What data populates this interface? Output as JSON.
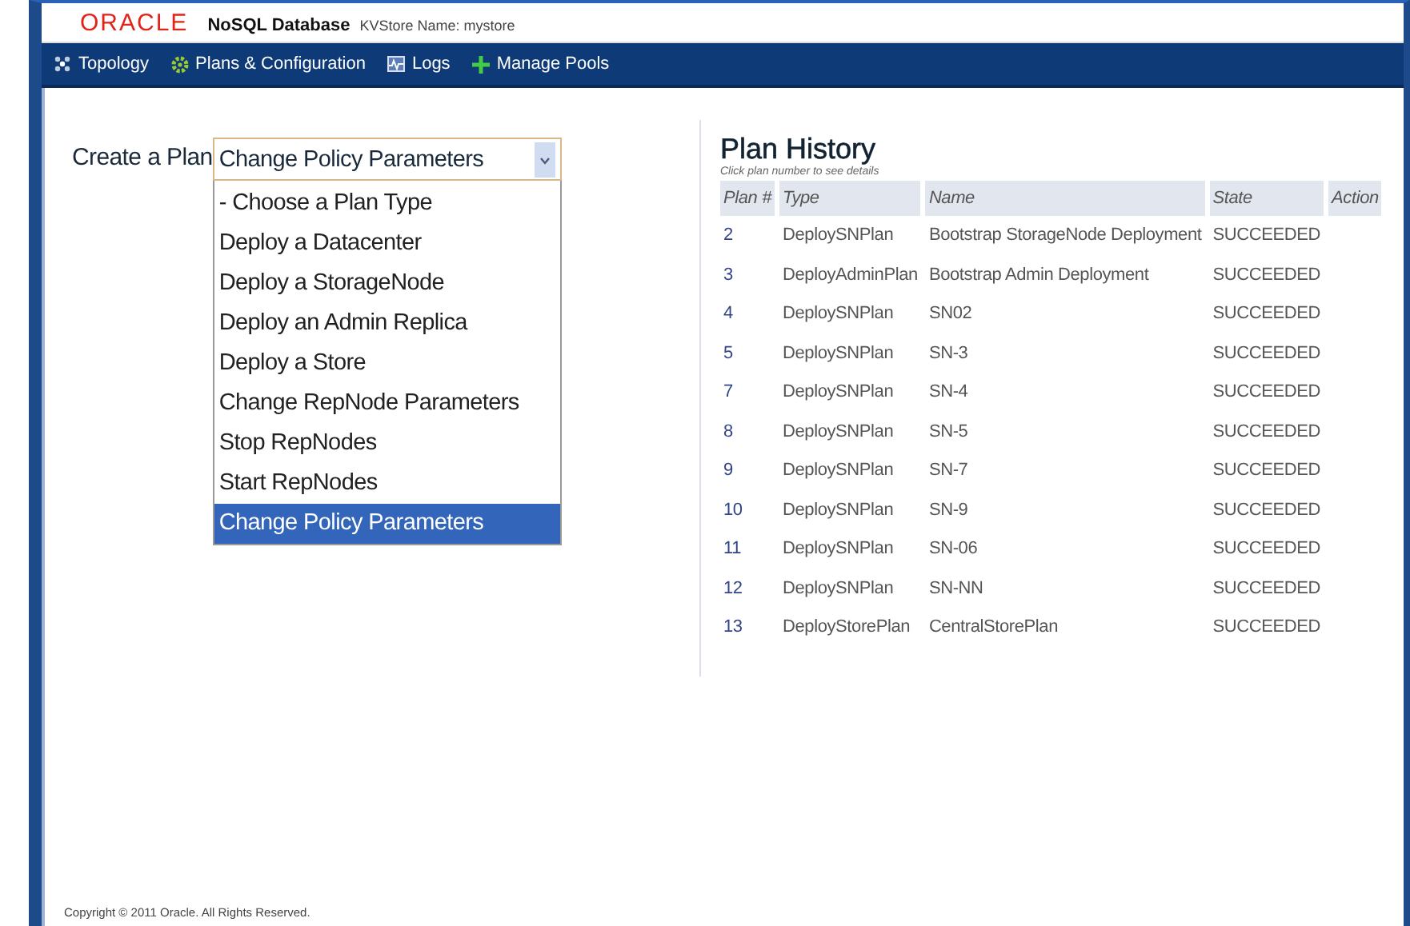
{
  "header": {
    "logo": "ORACLE",
    "product": "NoSQL Database",
    "store_label": "KVStore Name: mystore"
  },
  "nav": [
    {
      "label": "Topology"
    },
    {
      "label": "Plans & Configuration"
    },
    {
      "label": "Logs"
    },
    {
      "label": "Manage Pools"
    }
  ],
  "create_plan": {
    "label": "Create a Plan",
    "value": "Change Policy Parameters",
    "options": [
      {
        "label": "- Choose a Plan Type",
        "selected": false
      },
      {
        "label": "Deploy a Datacenter",
        "selected": false
      },
      {
        "label": "Deploy a StorageNode",
        "selected": false
      },
      {
        "label": "Deploy an Admin Replica",
        "selected": false
      },
      {
        "label": "Deploy a Store",
        "selected": false
      },
      {
        "label": "Change RepNode Parameters",
        "selected": false
      },
      {
        "label": "Stop RepNodes",
        "selected": false
      },
      {
        "label": "Start RepNodes",
        "selected": false
      },
      {
        "label": "Change Policy Parameters",
        "selected": true
      }
    ]
  },
  "plan_history": {
    "title": "Plan History",
    "hint": "Click plan number to see details",
    "columns": [
      "Plan #",
      "Type",
      "Name",
      "State",
      "Action"
    ],
    "rows": [
      [
        "2",
        "DeploySNPlan",
        "Bootstrap StorageNode Deployment",
        "SUCCEEDED"
      ],
      [
        "3",
        "DeployAdminPlan",
        "Bootstrap Admin Deployment",
        "SUCCEEDED"
      ],
      [
        "4",
        "DeploySNPlan",
        "SN02",
        "SUCCEEDED"
      ],
      [
        "5",
        "DeploySNPlan",
        "SN-3",
        "SUCCEEDED"
      ],
      [
        "7",
        "DeploySNPlan",
        "SN-4",
        "SUCCEEDED"
      ],
      [
        "8",
        "DeploySNPlan",
        "SN-5",
        "SUCCEEDED"
      ],
      [
        "9",
        "DeploySNPlan",
        "SN-7",
        "SUCCEEDED"
      ],
      [
        "10",
        "DeploySNPlan",
        "SN-9",
        "SUCCEEDED"
      ],
      [
        "11",
        "DeploySNPlan",
        "SN-06",
        "SUCCEEDED"
      ],
      [
        "12",
        "DeploySNPlan",
        "SN-NN",
        "SUCCEEDED"
      ],
      [
        "13",
        "DeployStorePlan",
        "CentralStorePlan",
        "SUCCEEDED"
      ]
    ]
  },
  "footer": "Copyright © 2011 Oracle. All Rights Reserved."
}
